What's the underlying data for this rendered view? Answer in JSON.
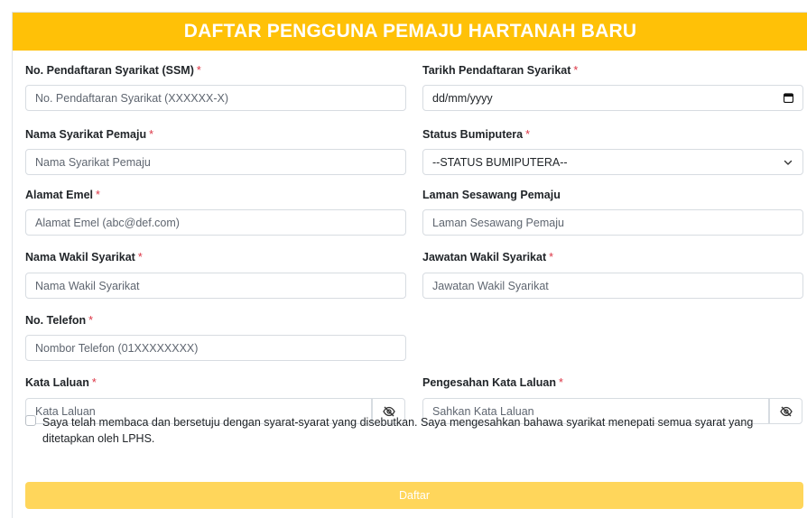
{
  "header": {
    "title": "DAFTAR PENGGUNA PEMAJU HARTANAH BARU"
  },
  "required_marker": "*",
  "fields": {
    "ssm": {
      "label": "No. Pendaftaran Syarikat (SSM)",
      "placeholder": "No. Pendaftaran Syarikat (XXXXXX-X)",
      "required": true
    },
    "reg_date": {
      "label": "Tarikh Pendaftaran Syarikat",
      "value": "dd/mm/yyyy",
      "required": true
    },
    "company_name": {
      "label": "Nama Syarikat Pemaju",
      "placeholder": "Nama Syarikat Pemaju",
      "required": true
    },
    "bumiputera": {
      "label": "Status Bumiputera",
      "selected": "--STATUS BUMIPUTERA--",
      "required": true
    },
    "email": {
      "label": "Alamat Emel",
      "placeholder": "Alamat Emel (abc@def.com)",
      "required": true
    },
    "website": {
      "label": "Laman Sesawang Pemaju",
      "placeholder": "Laman Sesawang Pemaju",
      "required": false
    },
    "rep_name": {
      "label": "Nama Wakil Syarikat",
      "placeholder": "Nama Wakil Syarikat",
      "required": true
    },
    "rep_position": {
      "label": "Jawatan Wakil Syarikat",
      "placeholder": "Jawatan Wakil Syarikat",
      "required": true
    },
    "phone": {
      "label": "No. Telefon",
      "placeholder": "Nombor Telefon (01XXXXXXXX)",
      "required": true
    },
    "password": {
      "label": "Kata Laluan",
      "placeholder": "Kata Laluan",
      "required": true
    },
    "password_confirm": {
      "label": "Pengesahan Kata Laluan",
      "placeholder": "Sahkan Kata Laluan",
      "required": true
    }
  },
  "agreement": {
    "text": "Saya telah membaca dan bersetuju dengan syarat-syarat yang disebutkan. Saya mengesahkan bahawa syarikat menepati semua syarat yang ditetapkan oleh LPHS.",
    "checked": false
  },
  "submit": {
    "label": "Daftar"
  },
  "icons": {
    "date": "calendar-icon",
    "select": "chevron-down-icon",
    "toggle_password": "eye-slash-icon"
  },
  "colors": {
    "header_bg": "#ffc107",
    "submit_bg": "#ffd65b",
    "required": "#dc3545"
  }
}
